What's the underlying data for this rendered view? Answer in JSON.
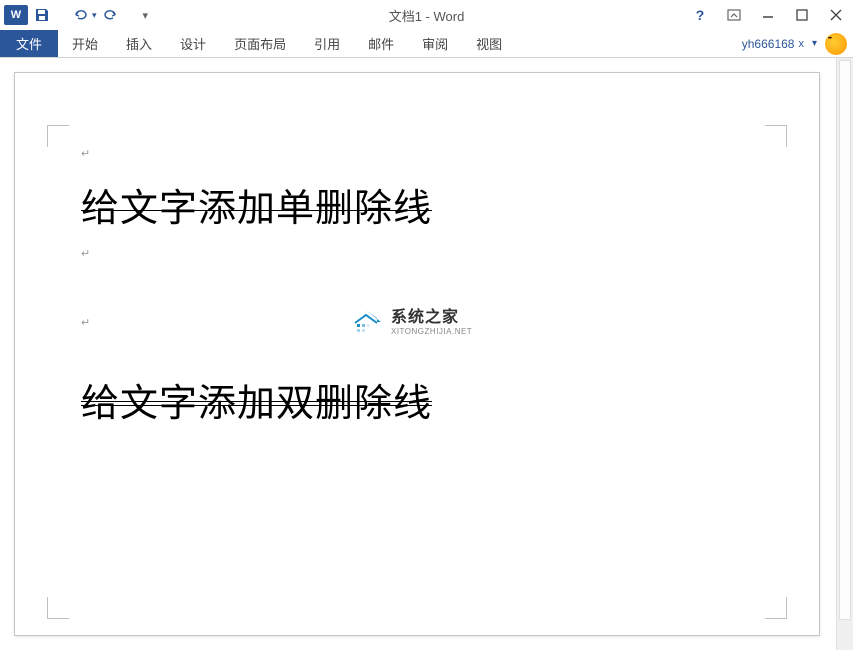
{
  "titlebar": {
    "title": "文档1 - Word",
    "app_abbr": "W"
  },
  "ribbon": {
    "file": "文件",
    "tabs": [
      "开始",
      "插入",
      "设计",
      "页面布局",
      "引用",
      "邮件",
      "审阅",
      "视图"
    ],
    "user": "yh666168",
    "user_x": "x"
  },
  "document": {
    "line1": "给文字添加单删除线",
    "line2": "给文字添加双删除线"
  },
  "watermark": {
    "cn": "系统之家",
    "en": "XITONGZHIJIA.NET"
  }
}
